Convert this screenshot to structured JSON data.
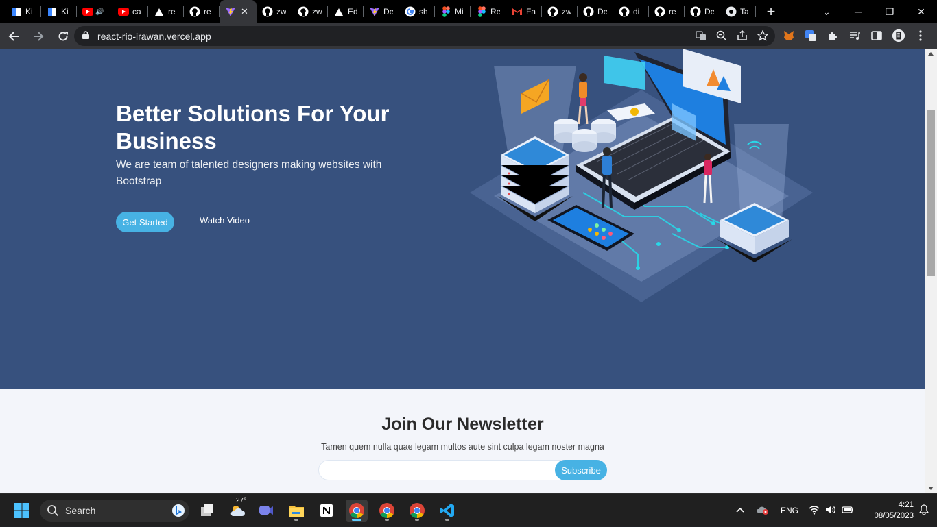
{
  "browser": {
    "tabs": [
      {
        "title": "Ki",
        "icon": "doc-blue-icon"
      },
      {
        "title": "Ki",
        "icon": "doc-blue-icon"
      },
      {
        "title": "",
        "icon": "youtube-icon",
        "audio": true
      },
      {
        "title": "ca",
        "icon": "youtube-icon"
      },
      {
        "title": "re",
        "icon": "vercel-icon"
      },
      {
        "title": "re",
        "icon": "github-icon"
      },
      {
        "title": "",
        "icon": "vite-icon",
        "active": true
      },
      {
        "title": "zw",
        "icon": "github-icon"
      },
      {
        "title": "zw",
        "icon": "github-icon"
      },
      {
        "title": "Ed",
        "icon": "vercel-icon"
      },
      {
        "title": "De",
        "icon": "vite-icon"
      },
      {
        "title": "sh",
        "icon": "google-icon"
      },
      {
        "title": "Mi",
        "icon": "figma-icon"
      },
      {
        "title": "Re",
        "icon": "figma-icon"
      },
      {
        "title": "Fa",
        "icon": "gmail-icon"
      },
      {
        "title": "zw",
        "icon": "github-icon"
      },
      {
        "title": "De",
        "icon": "github-icon"
      },
      {
        "title": "di",
        "icon": "github-icon"
      },
      {
        "title": "re",
        "icon": "github-icon"
      },
      {
        "title": "De",
        "icon": "github-icon"
      },
      {
        "title": "Ta",
        "icon": "chrome-icon"
      }
    ],
    "new_tab": "+",
    "url": "react-rio-irawan.vercel.app"
  },
  "page": {
    "hero": {
      "title": "Better Solutions For Your Business",
      "subtitle": "We are team of talented designers making websites with Bootstrap",
      "primary_button": "Get Started",
      "secondary_button": "Watch Video"
    },
    "newsletter": {
      "title": "Join Our Newsletter",
      "text": "Tamen quem nulla quae legam multos aute sint culpa legam noster magna",
      "email_value": "",
      "button": "Subscribe"
    }
  },
  "taskbar": {
    "search_label": "Search",
    "weather_temp": "27°",
    "language": "ENG",
    "time": "4:21",
    "date": "08/05/2023"
  },
  "colors": {
    "hero_bg": "#37517e",
    "accent": "#47b2e4",
    "newsletter_bg": "#f3f5fa"
  }
}
